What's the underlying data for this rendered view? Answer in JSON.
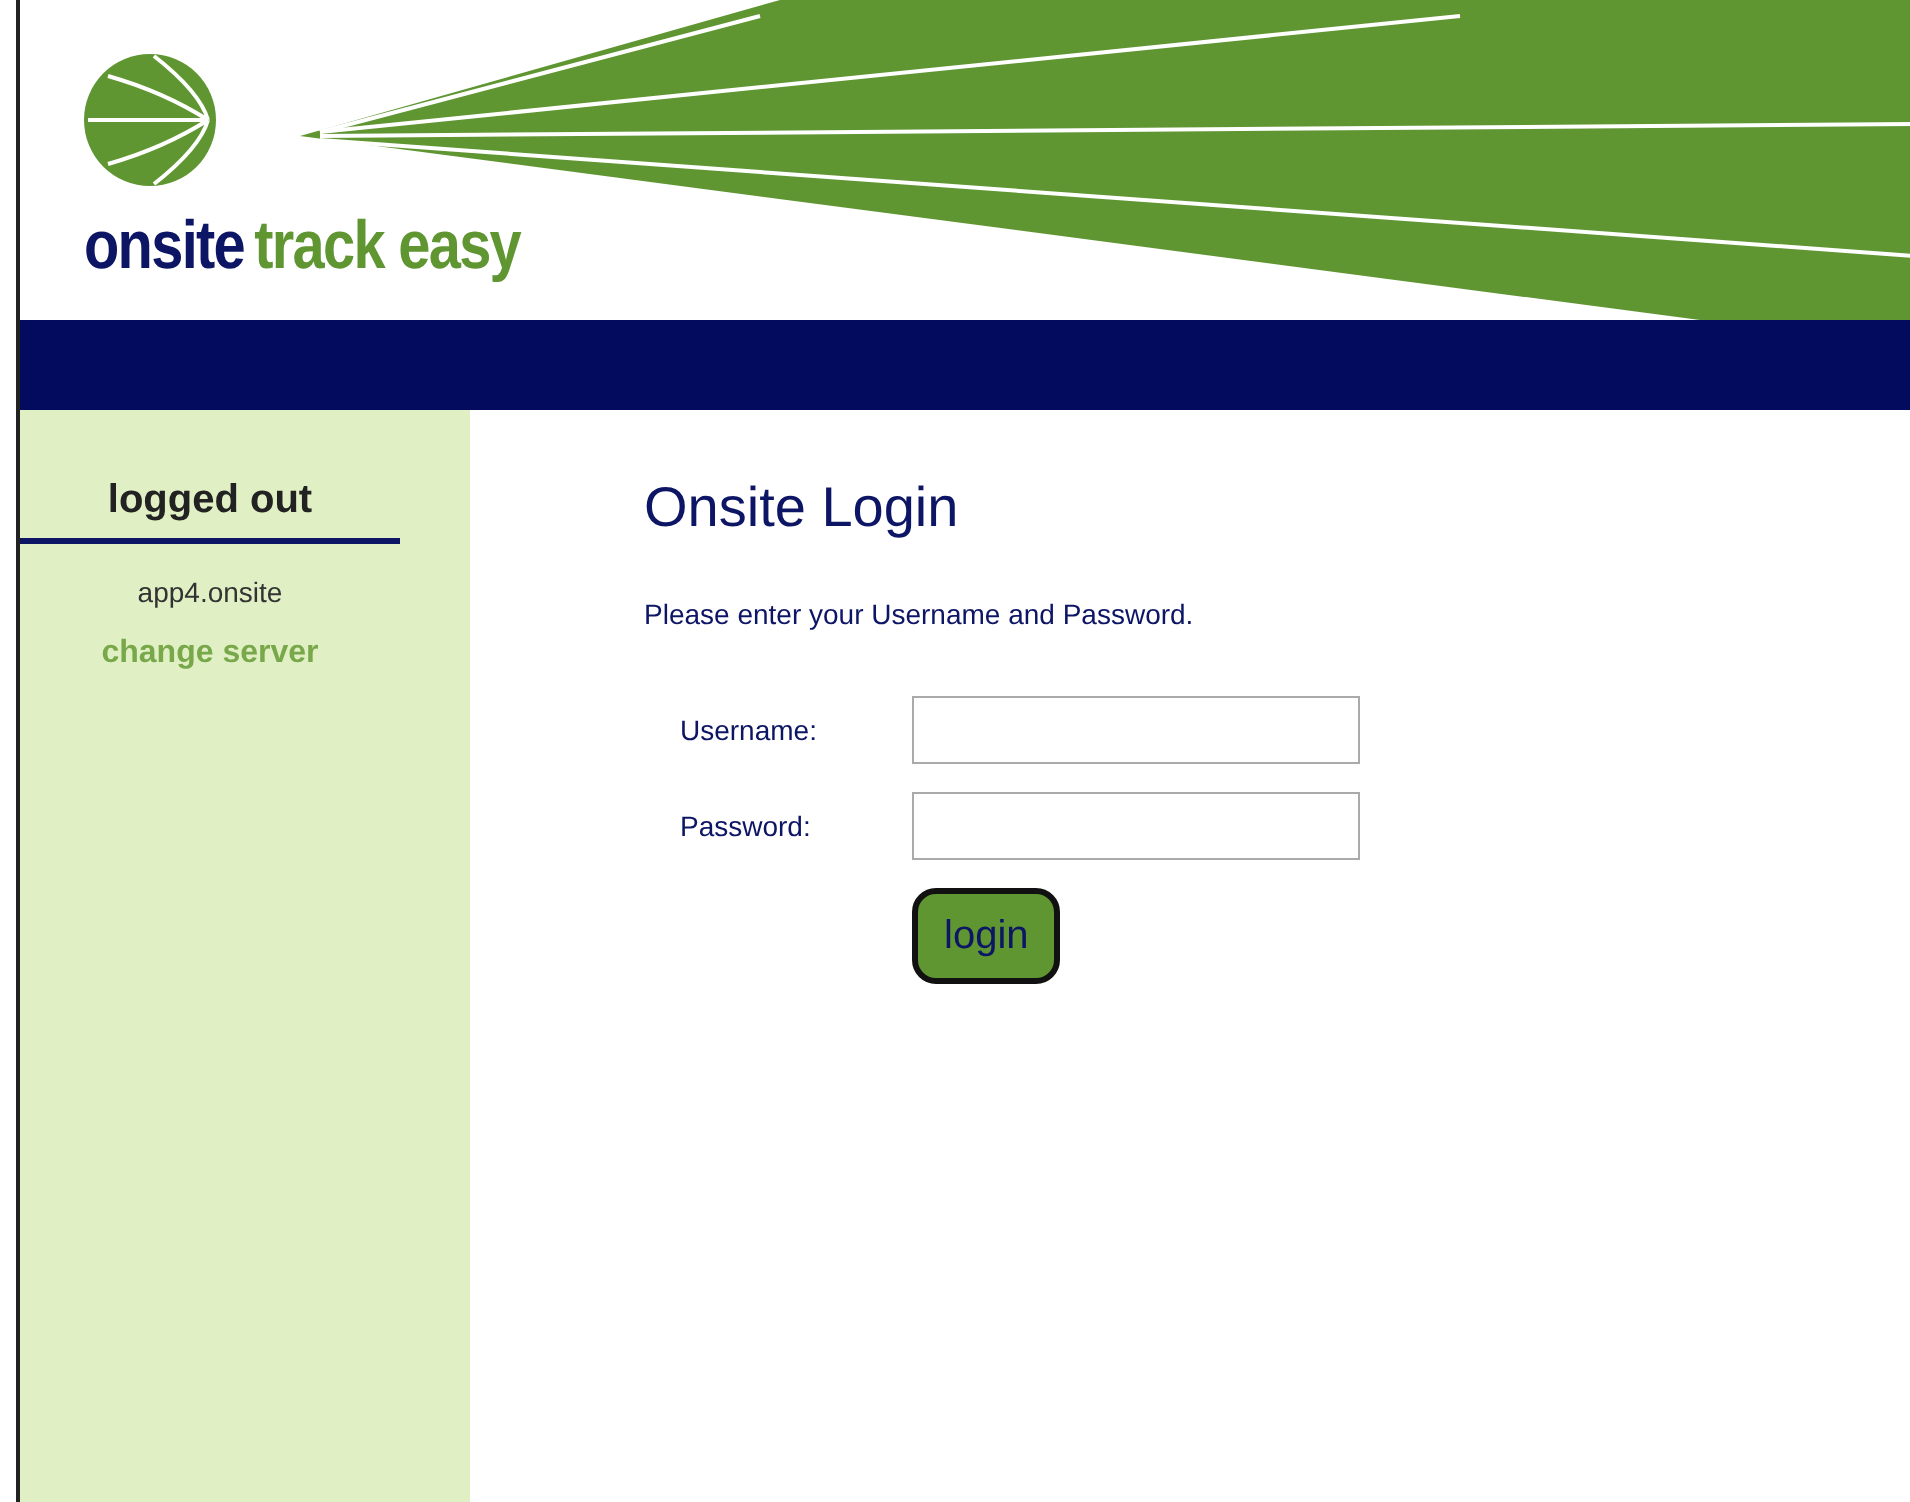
{
  "header": {
    "logo_primary": "onsite",
    "logo_secondary": "track easy"
  },
  "sidebar": {
    "status": "logged out",
    "server": "app4.onsite",
    "change_link": "change server"
  },
  "login": {
    "title": "Onsite Login",
    "instructions": "Please enter your Username and Password.",
    "fields": [
      {
        "label": "Username:"
      },
      {
        "label": "Password:"
      }
    ],
    "button": "login"
  }
}
